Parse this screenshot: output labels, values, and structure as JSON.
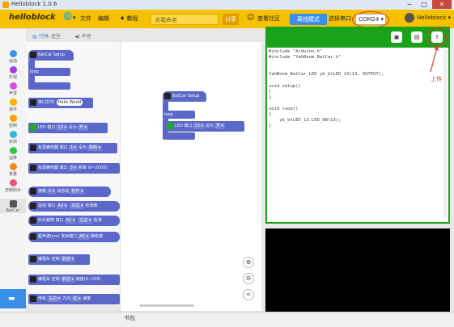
{
  "window": {
    "title": "Helloblock 1.0.6",
    "minimize": "─",
    "maximize": "□",
    "close": "✕"
  },
  "toolbar": {
    "logo": "helloblock",
    "file": "文件",
    "edit": "编辑",
    "board": "♦ 教程",
    "project_name": "点我命名",
    "save": "分享",
    "community": "查看社区",
    "mode": "离线模式",
    "port_label": "选择串口:",
    "port_value": "COM24",
    "user": "Helloblock ▾"
  },
  "categories": [
    {
      "label": "运动",
      "color": "#4a90e2"
    },
    {
      "label": "外观",
      "color": "#9b3fe0"
    },
    {
      "label": "声音",
      "color": "#d84fd1"
    },
    {
      "label": "事件",
      "color": "#f5b400"
    },
    {
      "label": "控制",
      "color": "#f0a500"
    },
    {
      "label": "侦测",
      "color": "#34b8d8"
    },
    {
      "label": "运算",
      "color": "#39c24a"
    },
    {
      "label": "变量",
      "color": "#ef8a22"
    },
    {
      "label": "自制积木",
      "color": "#e8557a"
    },
    {
      "label": "BatCar",
      "color": "#555555"
    }
  ],
  "tabs": {
    "code": "代码",
    "costumes": "造型",
    "sounds": "声音"
  },
  "flyout": {
    "setup_hat": "BatCar Setup",
    "loop": "loop",
    "serial_print": "串口打印",
    "serial_print_value": "Hello World",
    "led": "LED 端口",
    "led_port": "13",
    "led_set": "设为",
    "led_state": "开",
    "buzzer1": "有源蜂鸣器 端口",
    "buzzer1_port": "3",
    "buzzer1_set": "设为",
    "buzzer1_state": "鸣响",
    "buzzer2": "有源蜂鸣器 端口",
    "buzzer2_port": "3",
    "buzzer2_freq": "频率 (0~2000)",
    "button": "按键",
    "button_port": "2",
    "button_state": "状态是",
    "button_value": "松开",
    "tracking": "巡线 端口",
    "tracking_port": "A2",
    "tracking_side": "左边",
    "tracking_detect": "检测到",
    "ir": "红外避障 端口",
    "ir_port": "A2",
    "ir_side": "左边",
    "ir_detect": "检测",
    "ultrasonic": "超声波(cm) 发射端口",
    "ultrasonic_port": "A0",
    "ultrasonic_recv": "接收端",
    "car_ctrl": "编程车 控制",
    "car_ctrl_dir": "前进",
    "car_speed": "编程车 控制",
    "car_speed_dir": "前进",
    "car_speed_label": "速度(0~255)",
    "motor": "电机",
    "motor_side": "左边",
    "motor_dir": "方向",
    "motor_dir_value": "前",
    "motor_speed": "速度"
  },
  "workspace": {
    "setup_hat": "BatCar Setup",
    "loop": "loop",
    "led": "LED 端口",
    "led_port": "13",
    "led_set": "设为",
    "led_state": "开"
  },
  "code": {
    "text": "#include \"Arduino.h\"\n#include \"YahBoom_BatCar.h\"\n\n\nYahBoom_BatCar_LED yb_btLED_13(13, OUTPUT);\n\nvoid setup()\n{\n}\n\nvoid loop()\n{\n    yb_btLED_13.LED_ON(13);\n}\n",
    "upload_label": "上传"
  },
  "status": {
    "text": "书包"
  }
}
